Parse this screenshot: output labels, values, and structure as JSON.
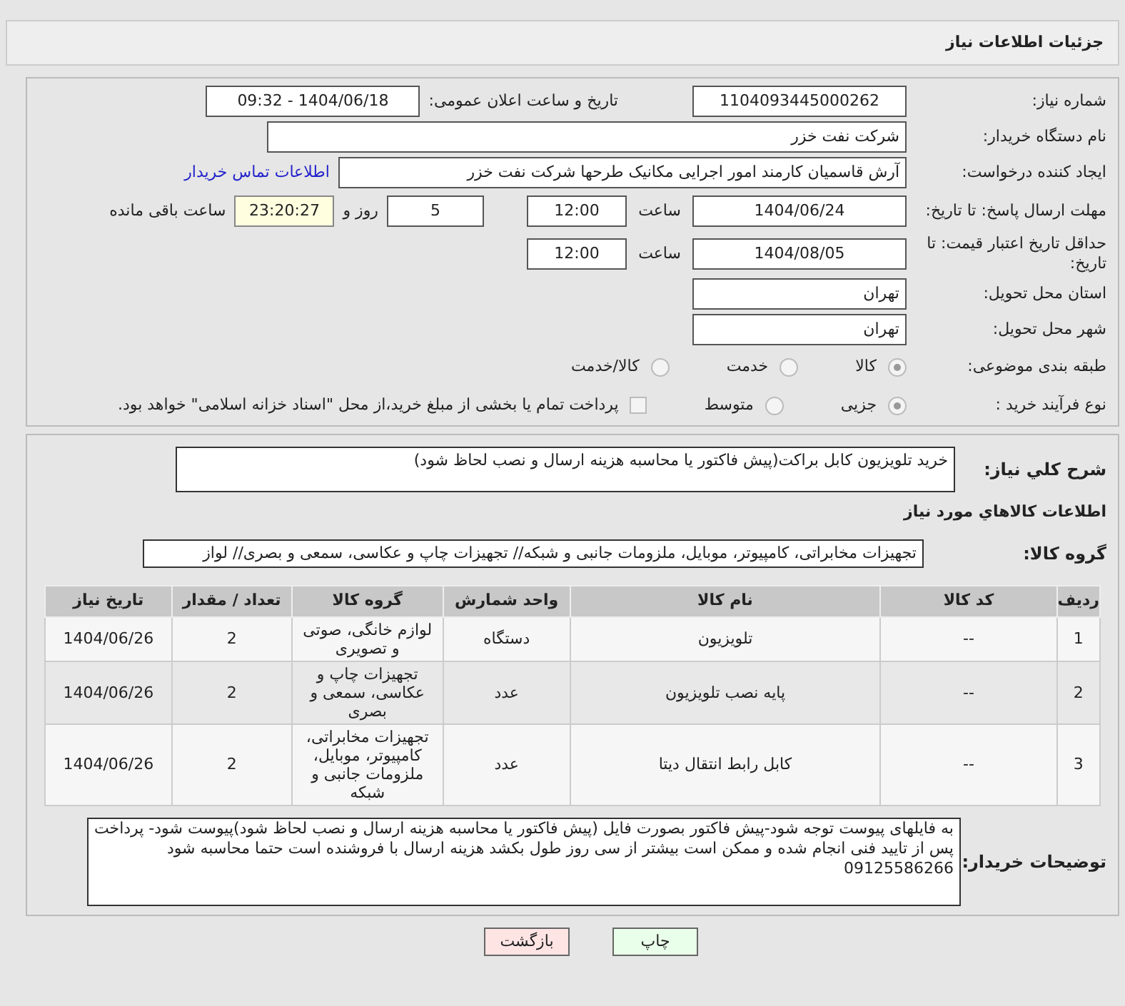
{
  "header": {
    "title": "جزئیات اطلاعات نیاز"
  },
  "need_number": {
    "label": "شماره نیاز:",
    "value": "1104093445000262"
  },
  "announce": {
    "label": "تاریخ و ساعت اعلان عمومی:",
    "value": "1404/06/18 - 09:32"
  },
  "buyer_org": {
    "label": "نام دستگاه خریدار:",
    "value": "شرکت نفت خزر"
  },
  "requester": {
    "label": "ایجاد کننده درخواست:",
    "value": "آرش قاسمیان کارمند امور اجرایی مکانیک طرحها شرکت نفت خزر",
    "link": "اطلاعات تماس خریدار"
  },
  "deadline": {
    "label": "مهلت ارسال پاسخ: تا تاریخ:",
    "date": "1404/06/24",
    "time_label": "ساعت",
    "time": "12:00",
    "days": "5",
    "days_label": "روز و",
    "remaining": "23:20:27",
    "remaining_label": "ساعت باقی مانده"
  },
  "validity": {
    "label": "حداقل تاریخ اعتبار قیمت: تا تاریخ:",
    "date": "1404/08/05",
    "time_label": "ساعت",
    "time": "12:00"
  },
  "province": {
    "label": "استان محل تحویل:",
    "value": "تهران"
  },
  "city": {
    "label": "شهر محل تحویل:",
    "value": "تهران"
  },
  "category": {
    "label": "طبقه بندی موضوعی:",
    "options": [
      {
        "label": "کالا",
        "selected": true
      },
      {
        "label": "خدمت",
        "selected": false
      },
      {
        "label": "کالا/خدمت",
        "selected": false
      }
    ]
  },
  "process": {
    "label": "نوع فرآیند خرید :",
    "options": [
      {
        "label": "جزیی",
        "selected": true
      },
      {
        "label": "متوسط",
        "selected": false
      }
    ],
    "checkbox": {
      "label": "پرداخت تمام یا بخشی از مبلغ خرید،از محل \"اسناد خزانه اسلامی\" خواهد بود.",
      "checked": false
    }
  },
  "description": {
    "label": "شرح کلي نياز:",
    "value": "خرید تلویزیون کابل براکت(پیش فاکتور یا محاسبه هزینه ارسال و نصب لحاظ شود)"
  },
  "goods_title": "اطلاعات کالاهاي مورد نياز",
  "goods_group": {
    "label": "گروه کالا:",
    "value": "تجهیزات مخابراتی، کامپیوتر، موبایل، ملزومات جانبی و شبکه// تجهیزات چاپ و عکاسی، سمعی و بصری// لواز"
  },
  "table": {
    "columns": [
      "ردیف",
      "کد کالا",
      "نام کالا",
      "واحد شمارش",
      "گروه کالا",
      "تعداد / مقدار",
      "تاریخ نیاز"
    ],
    "rows": [
      [
        "1",
        "--",
        "تلویزیون",
        "دستگاه",
        "لوازم خانگی، صوتی و تصویری",
        "2",
        "1404/06/26"
      ],
      [
        "2",
        "--",
        "پایه نصب تلویزیون",
        "عدد",
        "تجهیزات چاپ و عکاسی، سمعی و بصری",
        "2",
        "1404/06/26"
      ],
      [
        "3",
        "--",
        "کابل رابط انتقال دیتا",
        "عدد",
        "تجهیزات مخابراتی، کامپیوتر، موبایل، ملزومات جانبی و شبکه",
        "2",
        "1404/06/26"
      ]
    ]
  },
  "notes": {
    "label": "توضیحات خریدار:",
    "value": "به فایلهای پیوست توجه شود-پیش فاکتور بصورت فایل (پیش فاکتور یا محاسبه هزینه ارسال و نصب لحاظ شود)پیوست شود- پرداخت پس از تایید فنی انجام شده و ممکن است بیشتر از سی روز طول بکشد هزینه ارسال با فروشنده است حتما محاسبه شود 09125586266"
  },
  "buttons": [
    {
      "label": "چاپ",
      "kind": "print"
    },
    {
      "label": "بازگشت",
      "kind": "back"
    }
  ]
}
